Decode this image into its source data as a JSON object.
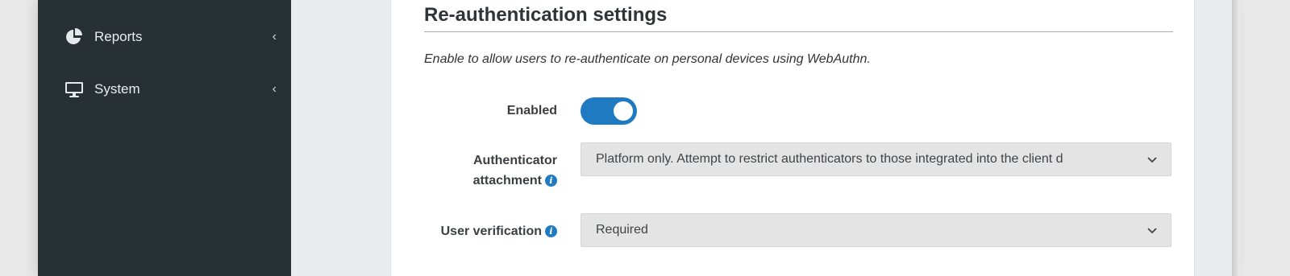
{
  "sidebar": {
    "items": [
      {
        "label": "Reports",
        "icon": "pie-chart-icon"
      },
      {
        "label": "System",
        "icon": "monitor-icon"
      }
    ]
  },
  "section": {
    "title": "Re-authentication settings",
    "hint": "Enable to allow users to re-authenticate on personal devices using WebAuthn."
  },
  "form": {
    "enabled": {
      "label": "Enabled",
      "value": true
    },
    "attachment": {
      "label_line1": "Authenticator",
      "label_line2": "attachment",
      "value": "Platform only. Attempt to restrict authenticators to those integrated into the client d"
    },
    "verification": {
      "label": "User verification",
      "value": "Required"
    }
  },
  "colors": {
    "sidebar_bg": "#263035",
    "accent": "#1f7ac2",
    "select_bg": "#e4e4e4"
  }
}
